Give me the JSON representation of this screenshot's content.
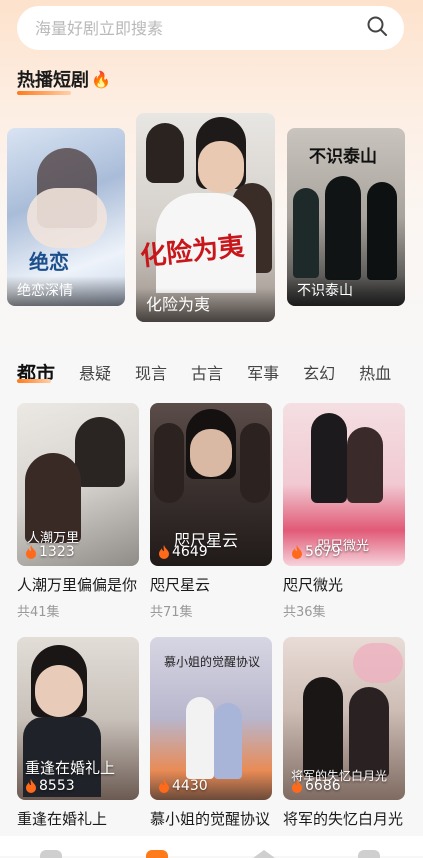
{
  "search": {
    "placeholder": "海量好剧立即搜素"
  },
  "hot_section": {
    "title": "热播短剧",
    "emoji": "🔥"
  },
  "hot_dramas": [
    {
      "title": "绝恋深情",
      "poster_text": "绝恋"
    },
    {
      "title": "化险为夷",
      "poster_text": "化险为夷"
    },
    {
      "title": "不识泰山",
      "poster_text": "不识泰山"
    }
  ],
  "category_tabs": [
    "都市",
    "悬疑",
    "现言",
    "古言",
    "军事",
    "玄幻",
    "热血"
  ],
  "active_tab": "都市",
  "dramas": [
    {
      "title": "人潮万里偏偏是你",
      "episodes": "共41集",
      "plays": "1323",
      "overlay": "人潮万里"
    },
    {
      "title": "咫尺星云",
      "episodes": "共71集",
      "plays": "4649",
      "overlay": "咫尺星云"
    },
    {
      "title": "咫尺微光",
      "episodes": "共36集",
      "plays": "5679",
      "overlay": "咫尺微光"
    },
    {
      "title": "重逢在婚礼上",
      "episodes": "",
      "plays": "8553",
      "overlay": "重逢在婚礼上"
    },
    {
      "title": "慕小姐的觉醒协议",
      "episodes": "",
      "plays": "4430",
      "overlay": "慕小姐的觉醒协议"
    },
    {
      "title": "将军的失忆白月光",
      "episodes": "",
      "plays": "6686",
      "overlay": "将军的失忆白月光"
    }
  ],
  "colors": {
    "accent": "#ff7a1a"
  }
}
